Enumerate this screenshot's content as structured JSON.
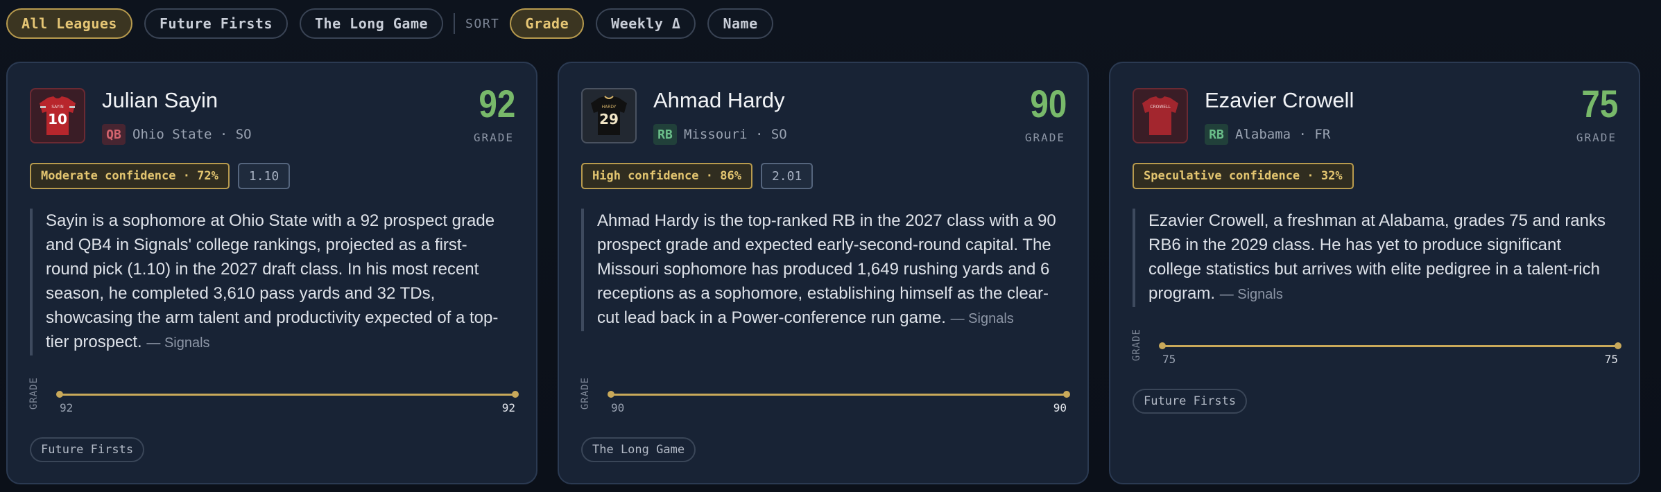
{
  "filters": {
    "leagues": [
      {
        "label": "All Leagues",
        "active": true
      },
      {
        "label": "Future Firsts",
        "active": false
      },
      {
        "label": "The Long Game",
        "active": false
      }
    ],
    "sort_label": "SORT",
    "sorts": [
      {
        "label": "Grade",
        "active": true
      },
      {
        "label": "Weekly Δ",
        "active": false
      },
      {
        "label": "Name",
        "active": false
      }
    ]
  },
  "cards": [
    {
      "name": "Julian Sayin",
      "position": "QB",
      "school_line": "Ohio State · SO",
      "grade": "92",
      "grade_label": "GRADE",
      "confidence": "Moderate confidence · 72%",
      "pick": "1.10",
      "summary": "Sayin is a sophomore at Ohio State with a 92 prospect grade and QB4 in Signals' college rankings, projected as a first-round pick (1.10) in the 2027 draft class. In his most recent season, he completed 3,610 pass yards and 32 TDs, showcasing the arm talent and productivity expected of a top-tier prospect.",
      "source": "— Signals",
      "track_label": "GRADE",
      "track_start": "92",
      "track_end": "92",
      "league_tag": "Future Firsts",
      "jersey": {
        "name": "SAYIN",
        "number": "10",
        "color": "#b8262c",
        "trim": "#c9c9c9",
        "box_bg": "#3a1d26",
        "box_border": "#6b2a33"
      }
    },
    {
      "name": "Ahmad Hardy",
      "position": "RB",
      "school_line": "Missouri · SO",
      "grade": "90",
      "grade_label": "GRADE",
      "confidence": "High confidence · 86%",
      "pick": "2.01",
      "summary": "Ahmad Hardy is the top-ranked RB in the 2027 class with a 90 prospect grade and expected early-second-round capital. The Missouri sophomore has produced 1,649 rushing yards and 6 receptions as a sophomore, establishing himself as the clear-cut lead back in a Power-conference run game.",
      "source": "— Signals",
      "track_label": "GRADE",
      "track_start": "90",
      "track_end": "90",
      "league_tag": "The Long Game",
      "jersey": {
        "name": "HARDY",
        "number": "29",
        "color": "#111111",
        "trim": "#d8b56a",
        "box_bg": "#222831",
        "box_border": "#4a5260"
      }
    },
    {
      "name": "Ezavier Crowell",
      "position": "RB",
      "school_line": "Alabama · FR",
      "grade": "75",
      "grade_label": "GRADE",
      "confidence": "Speculative confidence · 32%",
      "pick": "",
      "summary": "Ezavier Crowell, a freshman at Alabama, grades 75 and ranks RB6 in the 2029 class. He has yet to produce significant college statistics but arrives with elite pedigree in a talent-rich program.",
      "source": "— Signals",
      "track_label": "GRADE",
      "track_start": "75",
      "track_end": "75",
      "league_tag": "Future Firsts",
      "jersey": {
        "name": "CROWELL",
        "number": "",
        "color": "#a3262e",
        "trim": "#a3262e",
        "box_bg": "#3a1d26",
        "box_border": "#6b2a33"
      }
    }
  ]
}
